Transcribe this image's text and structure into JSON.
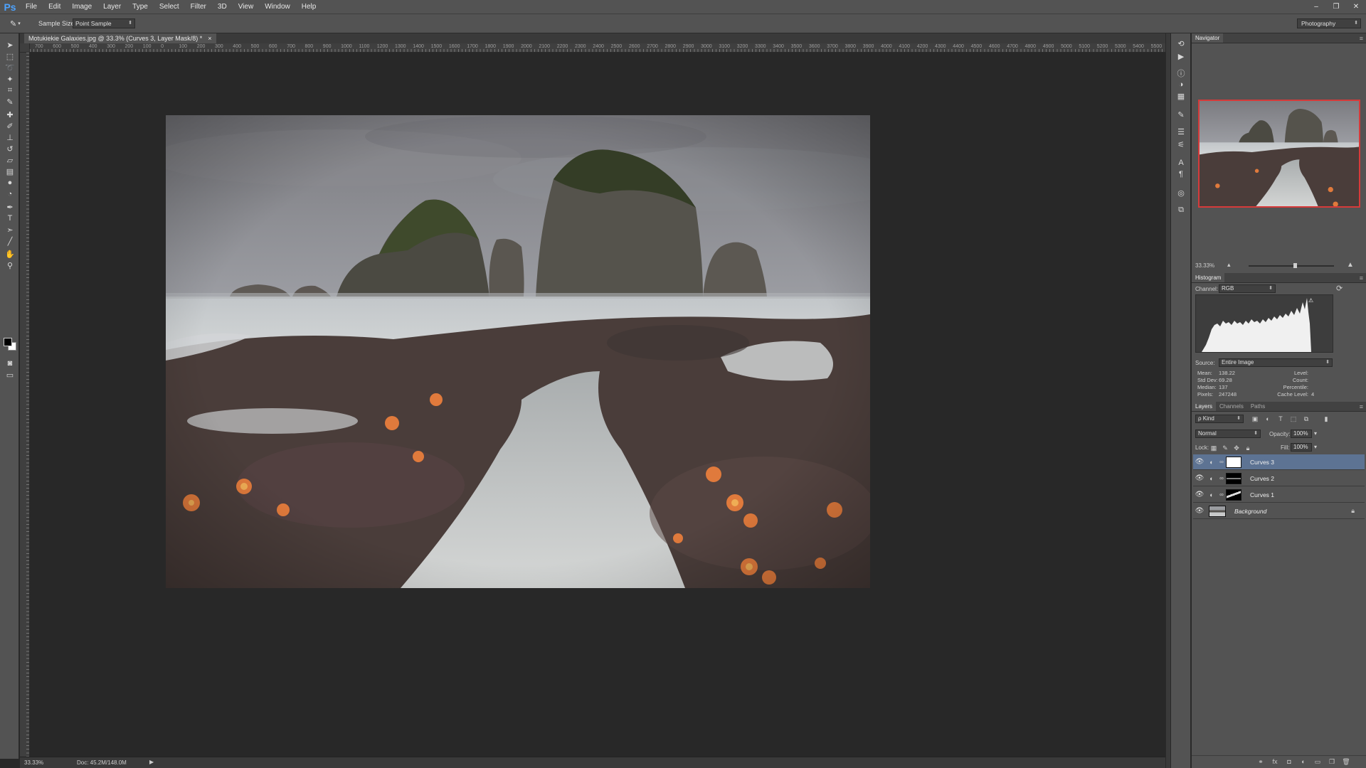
{
  "app": {
    "logo": "Ps",
    "menu": [
      "File",
      "Edit",
      "Image",
      "Layer",
      "Type",
      "Select",
      "Filter",
      "3D",
      "View",
      "Window",
      "Help"
    ],
    "window_controls": [
      "–",
      "❐",
      "✕"
    ]
  },
  "options_bar": {
    "tool_icon": "eyedropper-icon",
    "sample_size_label": "Sample Size:",
    "sample_size_value": "Point Sample",
    "workspace": "Photography"
  },
  "document": {
    "tab_title": "Motukiekie Galaxies.jpg @ 33.3% (Curves 3, Layer Mask/8) *",
    "tab_close": "×",
    "ruler_labels": [
      "700",
      "600",
      "500",
      "400",
      "300",
      "200",
      "100",
      "0",
      "100",
      "200",
      "300",
      "400",
      "500",
      "600",
      "700",
      "800",
      "900",
      "1000",
      "1100",
      "1200",
      "1300",
      "1400",
      "1500",
      "1600",
      "1700",
      "1800",
      "1900",
      "2000",
      "2100",
      "2200",
      "2300",
      "2400",
      "2500",
      "2600",
      "2700",
      "2800",
      "2900",
      "3000",
      "3100",
      "3200",
      "3300",
      "3400",
      "3500",
      "3600",
      "3700",
      "3800",
      "3900",
      "4000",
      "4100",
      "4200",
      "4300",
      "4400",
      "4500",
      "4600",
      "4700",
      "4800",
      "4900",
      "5000",
      "5100",
      "5200",
      "5300",
      "5400",
      "5500"
    ],
    "zoom": "33.33%",
    "doc_size": "Doc: 45.2M/148.0M"
  },
  "navigator": {
    "tabs": [
      "Navigator"
    ],
    "zoom": "33.33%"
  },
  "histogram": {
    "tabs": [
      "Histogram"
    ],
    "channel_label": "Channel:",
    "channel_value": "RGB",
    "source_label": "Source:",
    "source_value": "Entire Image",
    "stats_left": [
      {
        "label": "Mean:",
        "value": "138.22"
      },
      {
        "label": "Std Dev:",
        "value": "69.28"
      },
      {
        "label": "Median:",
        "value": "137"
      },
      {
        "label": "Pixels:",
        "value": "247248"
      }
    ],
    "stats_right": [
      {
        "label": "Level:",
        "value": ""
      },
      {
        "label": "Count:",
        "value": ""
      },
      {
        "label": "Percentile:",
        "value": ""
      },
      {
        "label": "Cache Level:",
        "value": "4"
      }
    ]
  },
  "layers": {
    "tabs": [
      "Layers",
      "Channels",
      "Paths"
    ],
    "kind_filter": "ρ Kind",
    "blend_mode": "Normal",
    "opacity_label": "Opacity:",
    "opacity_value": "100%",
    "lock_label": "Lock:",
    "fill_label": "Fill:",
    "fill_value": "100%",
    "items": [
      {
        "name": "Curves 3",
        "selected": true
      },
      {
        "name": "Curves 2",
        "selected": false
      },
      {
        "name": "Curves 1",
        "selected": false
      },
      {
        "name": "Background",
        "selected": false
      }
    ]
  },
  "colors": {
    "accent_selection": "#5d7393",
    "navigator_frame": "#d63a3a",
    "ps_blue": "#4da3ff"
  }
}
